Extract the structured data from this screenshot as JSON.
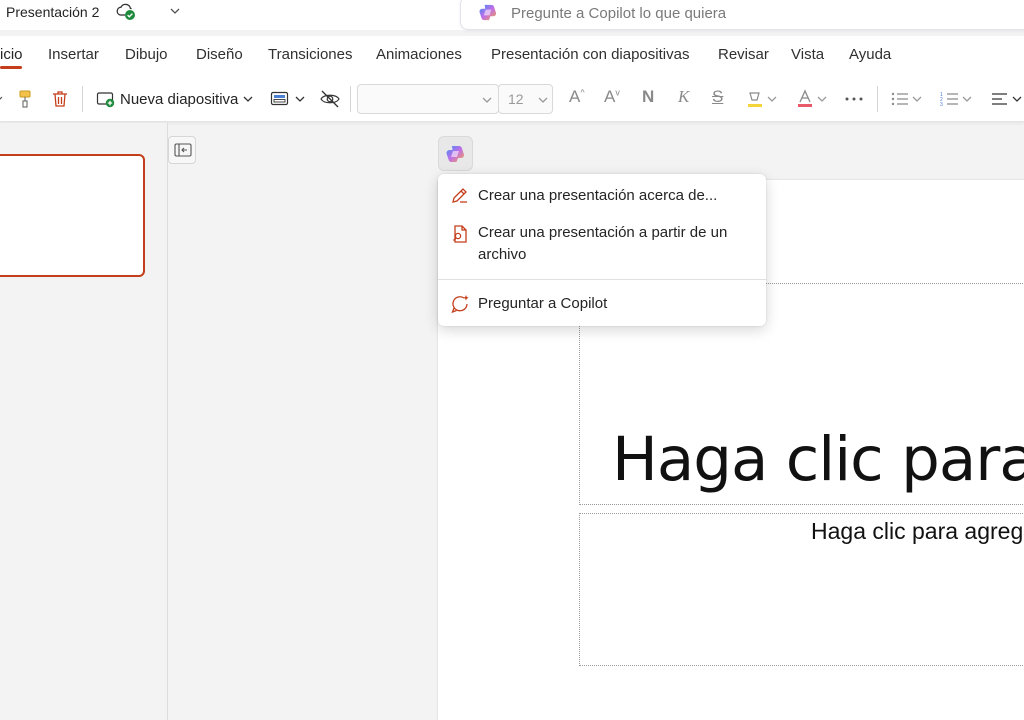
{
  "titlebar": {
    "doc_title": "Presentación 2",
    "search_placeholder": "Pregunte a Copilot lo que quiera"
  },
  "tabs": [
    {
      "label": "icio",
      "active": true
    },
    {
      "label": "Insertar"
    },
    {
      "label": "Dibujo"
    },
    {
      "label": "Diseño"
    },
    {
      "label": "Transiciones"
    },
    {
      "label": "Animaciones"
    },
    {
      "label": "Presentación con diapositivas"
    },
    {
      "label": "Revisar"
    },
    {
      "label": "Vista"
    },
    {
      "label": "Ayuda"
    }
  ],
  "toolbar": {
    "new_slide_label": "Nueva diapositiva",
    "font_size": "12",
    "bold_glyph": "N",
    "italic_glyph": "K",
    "strike_glyph": "S",
    "grow_glyph": "A",
    "shrink_glyph": "A"
  },
  "menu": {
    "items": [
      {
        "label": "Crear una presentación acerca de...",
        "icon": "pen-sparkle-icon"
      },
      {
        "label": "Crear una presentación a partir de un archivo",
        "icon": "document-search-icon"
      },
      {
        "label": "Preguntar a Copilot",
        "icon": "chat-sparkle-icon"
      }
    ]
  },
  "slide": {
    "title_placeholder": "Haga clic para agregar título",
    "subtitle_placeholder": "Haga clic para agregar subtítulo"
  },
  "colors": {
    "accent": "#c43e1c",
    "sync_ok": "#1e8a3c"
  }
}
